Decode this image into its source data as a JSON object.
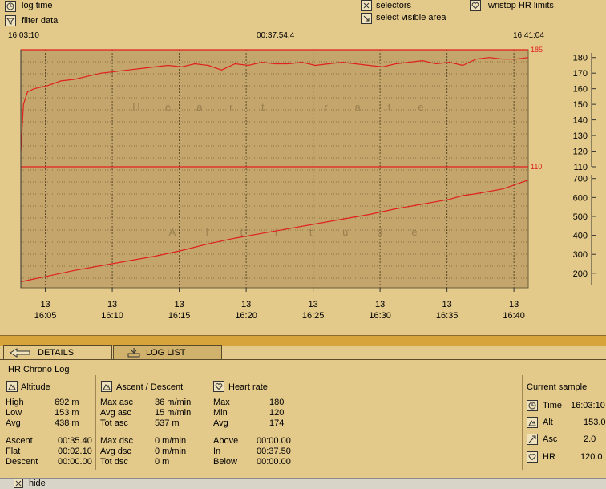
{
  "toolbar": {
    "log_time": "log time",
    "filter_data": "filter data",
    "selectors": "selectors",
    "select_visible_area": "select visible area",
    "wristop_hr_limits": "wristop HR limits"
  },
  "time_range": {
    "start": "16:03:10",
    "mid": "00:37.54,4",
    "end": "16:41:04"
  },
  "chart_data": [
    {
      "type": "line",
      "title": "Heart rate",
      "color": "#e02020",
      "y_axis_ticks": [
        110,
        120,
        130,
        140,
        150,
        160,
        170,
        180
      ],
      "ylim": [
        110,
        185
      ],
      "hr_limit_high": "185",
      "hr_limit_low": "110",
      "x_minutes": [
        0,
        0.2,
        0.5,
        1,
        2,
        3,
        4,
        5,
        6,
        7,
        8,
        9,
        10,
        11,
        12,
        13,
        14,
        15,
        16,
        17,
        18,
        19,
        20,
        21,
        22,
        23,
        24,
        25,
        26,
        27,
        28,
        29,
        30,
        31,
        32,
        33,
        34,
        35,
        36,
        37,
        37.9
      ],
      "values": [
        120,
        150,
        158,
        160,
        162,
        165,
        166,
        168,
        170,
        171,
        172,
        173,
        174,
        175,
        174,
        176,
        175,
        172,
        176,
        175,
        177,
        176,
        176,
        177,
        175,
        176,
        177,
        176,
        175,
        174,
        176,
        177,
        178,
        176,
        177,
        175,
        179,
        180,
        179,
        179,
        180
      ]
    },
    {
      "type": "line",
      "title": "Altitude",
      "color": "#e02020",
      "y_axis_ticks": [
        200,
        300,
        400,
        500,
        600,
        700
      ],
      "ylim": [
        140,
        720
      ],
      "x_minutes": [
        0,
        2,
        4,
        6,
        8,
        10,
        12,
        14,
        16,
        18,
        20,
        22,
        24,
        26,
        28,
        30,
        32,
        33,
        34,
        36,
        37.9
      ],
      "values": [
        155,
        185,
        215,
        240,
        265,
        290,
        320,
        355,
        385,
        410,
        435,
        460,
        485,
        510,
        540,
        565,
        590,
        610,
        620,
        645,
        692
      ]
    }
  ],
  "x_axis_ticks": [
    {
      "day": "13",
      "time": "16:05",
      "minute": 1.83
    },
    {
      "day": "13",
      "time": "16:10",
      "minute": 6.83
    },
    {
      "day": "13",
      "time": "16:15",
      "minute": 11.83
    },
    {
      "day": "13",
      "time": "16:20",
      "minute": 16.83
    },
    {
      "day": "13",
      "time": "16:25",
      "minute": 21.83
    },
    {
      "day": "13",
      "time": "16:30",
      "minute": 26.83
    },
    {
      "day": "13",
      "time": "16:35",
      "minute": 31.83
    },
    {
      "day": "13",
      "time": "16:40",
      "minute": 36.83
    }
  ],
  "tabs": {
    "details": "DETAILS",
    "log_list": "LOG LIST"
  },
  "details": {
    "log_title": "HR Chrono Log",
    "altitude": {
      "title": "Altitude",
      "high_label": "High",
      "high": "692 m",
      "low_label": "Low",
      "low": "153 m",
      "avg_label": "Avg",
      "avg": "438 m",
      "ascent_label": "Ascent",
      "ascent": "00:35.40",
      "flat_label": "Flat",
      "flat": "00:02.10",
      "descent_label": "Descent",
      "descent": "00:00.00"
    },
    "ascent_descent": {
      "title": "Ascent / Descent",
      "max_asc_label": "Max asc",
      "max_asc": "36 m/min",
      "avg_asc_label": "Avg asc",
      "avg_asc": "15 m/min",
      "tot_asc_label": "Tot asc",
      "tot_asc": "537 m",
      "max_dsc_label": "Max dsc",
      "max_dsc": "0 m/min",
      "avg_dsc_label": "Avg dsc",
      "avg_dsc": "0 m/min",
      "tot_dsc_label": "Tot dsc",
      "tot_dsc": "0 m"
    },
    "heart_rate": {
      "title": "Heart rate",
      "max_label": "Max",
      "max": "180",
      "min_label": "Min",
      "min": "120",
      "avg_label": "Avg",
      "avg": "174",
      "above_label": "Above",
      "above": "00:00.00",
      "in_label": "In",
      "in": "00:37.50",
      "below_label": "Below",
      "below": "00:00.00"
    },
    "current_sample": {
      "title": "Current sample",
      "time_label": "Time",
      "time": "16:03:10",
      "alt_label": "Alt",
      "alt": "153.0",
      "asc_label": "Asc",
      "asc": "2.0",
      "hr_label": "HR",
      "hr": "120.0"
    }
  },
  "bottom": {
    "hide": "hide"
  }
}
